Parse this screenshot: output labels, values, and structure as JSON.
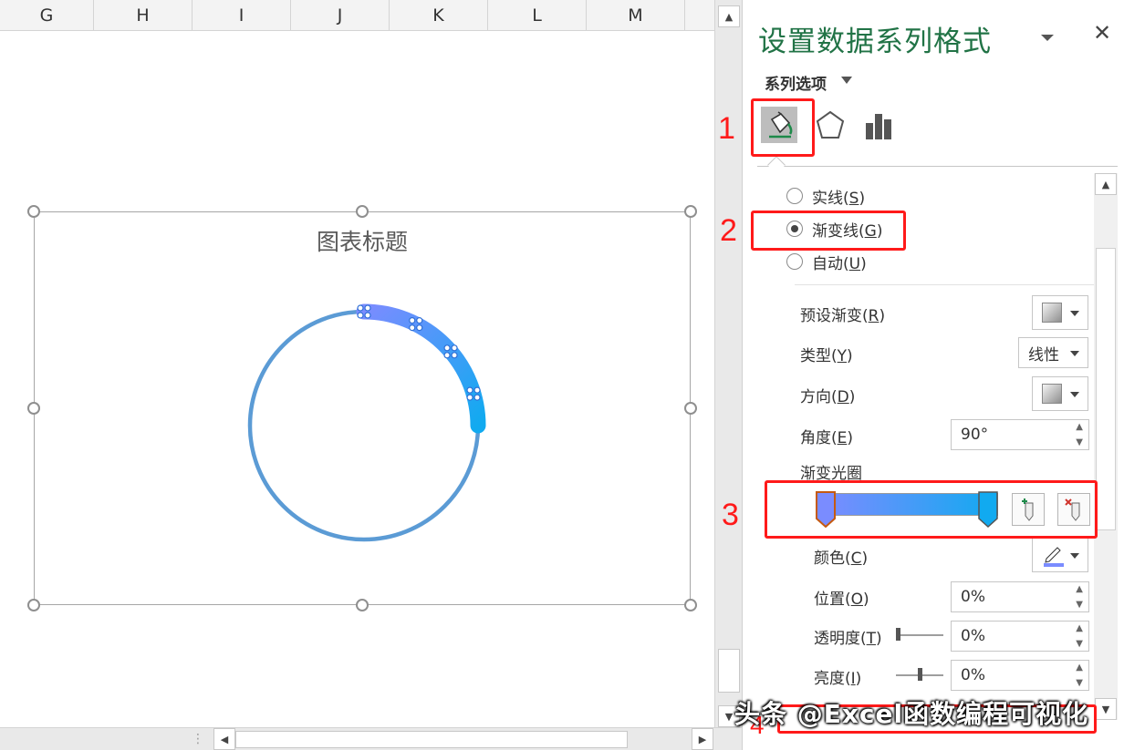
{
  "sheet": {
    "columns": [
      "G",
      "H",
      "I",
      "J",
      "K",
      "L",
      "M"
    ]
  },
  "chart": {
    "title": "图表标题",
    "ring_color": "#5b9bd5",
    "gradient_start": "#7a8cff",
    "gradient_end": "#11aaf0",
    "highlighted_fraction": 0.25
  },
  "pane": {
    "title": "设置数据系列格式",
    "series_options_label": "系列选项",
    "tabs": [
      {
        "name": "fill-line-icon",
        "selected": true
      },
      {
        "name": "effects-pentagon-icon",
        "selected": false
      },
      {
        "name": "series-options-bars-icon",
        "selected": false
      }
    ],
    "line_options": {
      "solid": {
        "label": "实线(",
        "key": "S",
        "end": ")"
      },
      "gradient": {
        "label": "渐变线(",
        "key": "G",
        "end": ")",
        "selected": true
      },
      "auto": {
        "label": "自动(",
        "key": "U",
        "end": ")"
      }
    },
    "preset_gradient": {
      "label": "预设渐变(",
      "key": "R",
      "end": ")"
    },
    "type": {
      "label": "类型(",
      "key": "Y",
      "end": ")",
      "value": "线性"
    },
    "direction": {
      "label": "方向(",
      "key": "D",
      "end": ")"
    },
    "angle": {
      "label": "角度(",
      "key": "E",
      "end": ")",
      "value": "90°"
    },
    "gradient_stops_label": "渐变光圈",
    "color": {
      "label": "颜色(",
      "key": "C",
      "end": ")"
    },
    "position": {
      "label": "位置(",
      "key": "O",
      "end": ")",
      "value": "0%"
    },
    "transparency": {
      "label": "透明度(",
      "key": "T",
      "end": ")",
      "value": "0%"
    },
    "brightness": {
      "label": "亮度(",
      "key": "I",
      "end": ")",
      "value": "0%"
    }
  },
  "annotations": {
    "n1": "1",
    "n2": "2",
    "n3": "3",
    "n4": "4",
    "color": "#ff1a1a"
  },
  "watermark": "头条 @Excel函数编程可视化"
}
